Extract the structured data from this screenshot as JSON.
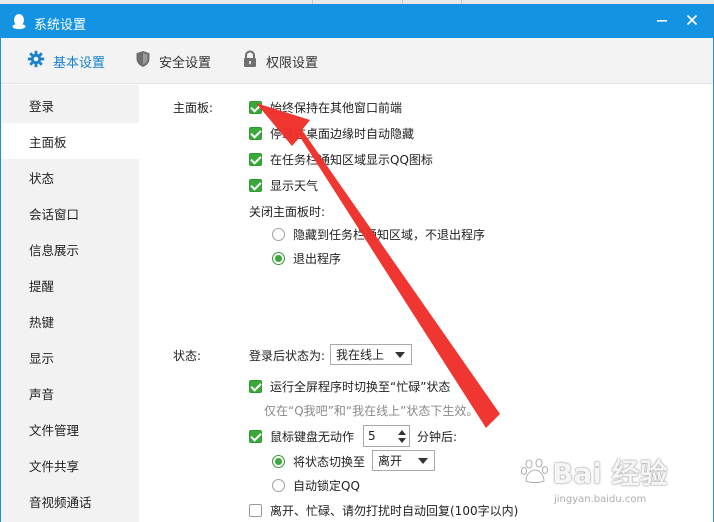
{
  "window": {
    "title": "系统设置"
  },
  "tabs": [
    {
      "label": "基本设置",
      "icon": "gear-icon",
      "active": true
    },
    {
      "label": "安全设置",
      "icon": "shield-icon",
      "active": false
    },
    {
      "label": "权限设置",
      "icon": "lock-icon",
      "active": false
    }
  ],
  "sidebar": {
    "items": [
      {
        "label": "登录"
      },
      {
        "label": "主面板",
        "active": true
      },
      {
        "label": "状态"
      },
      {
        "label": "会话窗口"
      },
      {
        "label": "信息展示"
      },
      {
        "label": "提醒"
      },
      {
        "label": "热键"
      },
      {
        "label": "显示"
      },
      {
        "label": "声音"
      },
      {
        "label": "文件管理"
      },
      {
        "label": "文件共享"
      },
      {
        "label": "音视频通话"
      }
    ]
  },
  "main_panel": {
    "section_label": "主面板:",
    "options": [
      {
        "label": "始终保持在其他窗口前端",
        "checked": true
      },
      {
        "label": "停靠在桌面边缘时自动隐藏",
        "checked": true
      },
      {
        "label": "在任务栏通知区域显示QQ图标",
        "checked": true
      },
      {
        "label": "显示天气",
        "checked": true
      }
    ],
    "close_label": "关闭主面板时:",
    "close_options": [
      {
        "label": "隐藏到任务栏通知区域，不退出程序",
        "selected": false
      },
      {
        "label": "退出程序",
        "selected": true
      }
    ]
  },
  "status": {
    "section_label": "状态:",
    "after_login_label": "登录后状态为:",
    "after_login_value": "我在线上",
    "fullscreen_busy": {
      "label": "运行全屏程序时切换至“忙碌”状态",
      "checked": true
    },
    "fullscreen_hint": "仅在“Q我吧”和“我在线上”状态下生效。",
    "idle": {
      "label": "鼠标键盘无动作",
      "checked": true,
      "minutes": "5",
      "suffix": "分钟后:"
    },
    "idle_options": [
      {
        "label": "将状态切换至",
        "selected": true,
        "value": "离开"
      },
      {
        "label": "自动锁定QQ",
        "selected": false
      }
    ],
    "auto_reply": {
      "label": "离开、忙碌、请勿打扰时自动回复(100字以内)",
      "checked": false
    }
  },
  "watermark": {
    "text": "Bai 经验",
    "sub": "jingyan.baidu.com"
  },
  "colors": {
    "titlebar": "#1593e3",
    "accent": "#1a82c9",
    "check_green": "#39a93a",
    "arrow_red": "#f0302a"
  }
}
